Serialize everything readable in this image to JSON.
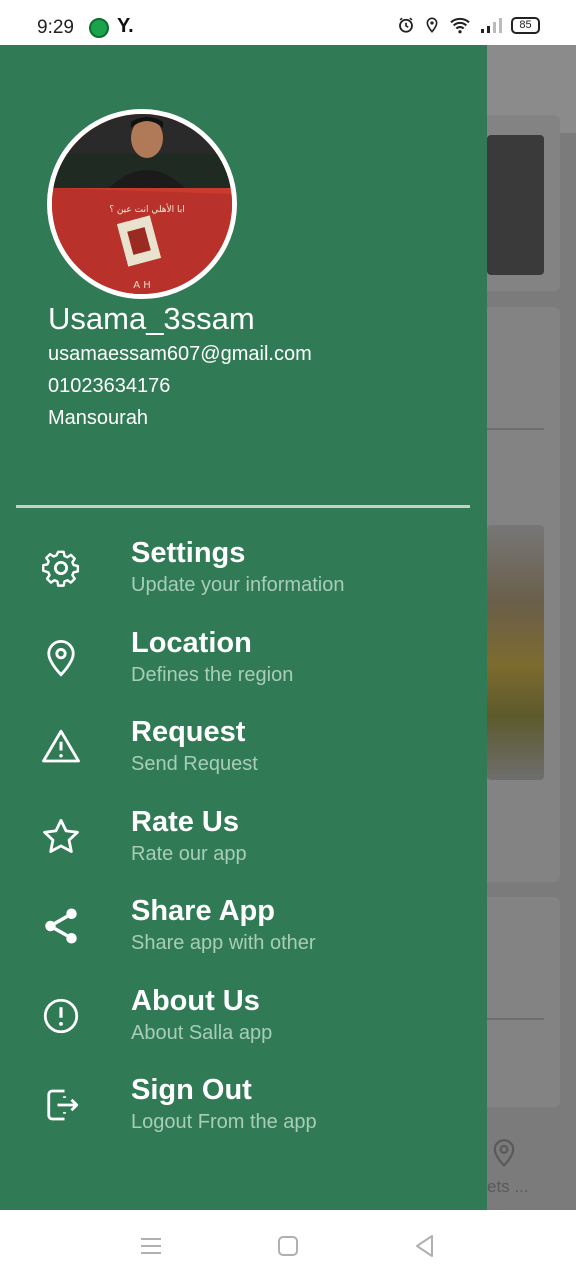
{
  "status_bar": {
    "time": "9:29",
    "carrier_icon": "Y.",
    "battery": "85"
  },
  "background": {
    "nav_label": "ets ..."
  },
  "drawer": {
    "profile": {
      "name": "Usama_3ssam",
      "email": "usamaessam607@gmail.com",
      "phone": "01023634176",
      "city": "Mansourah"
    },
    "menu": [
      {
        "icon": "gear-icon",
        "title": "Settings",
        "subtitle": "Update your information"
      },
      {
        "icon": "location-pin-icon",
        "title": "Location",
        "subtitle": "Defines the region"
      },
      {
        "icon": "warning-icon",
        "title": "Request",
        "subtitle": "Send Request"
      },
      {
        "icon": "star-icon",
        "title": "Rate Us",
        "subtitle": "Rate our app"
      },
      {
        "icon": "share-icon",
        "title": "Share App",
        "subtitle": "Share app with other"
      },
      {
        "icon": "info-icon",
        "title": "About Us",
        "subtitle": "About Salla app"
      },
      {
        "icon": "logout-icon",
        "title": "Sign Out",
        "subtitle": "Logout From the app"
      }
    ]
  },
  "colors": {
    "drawer_bg": "#307b55",
    "subtitle": "#a8cdb8",
    "scrim": "#7b7b7b"
  }
}
